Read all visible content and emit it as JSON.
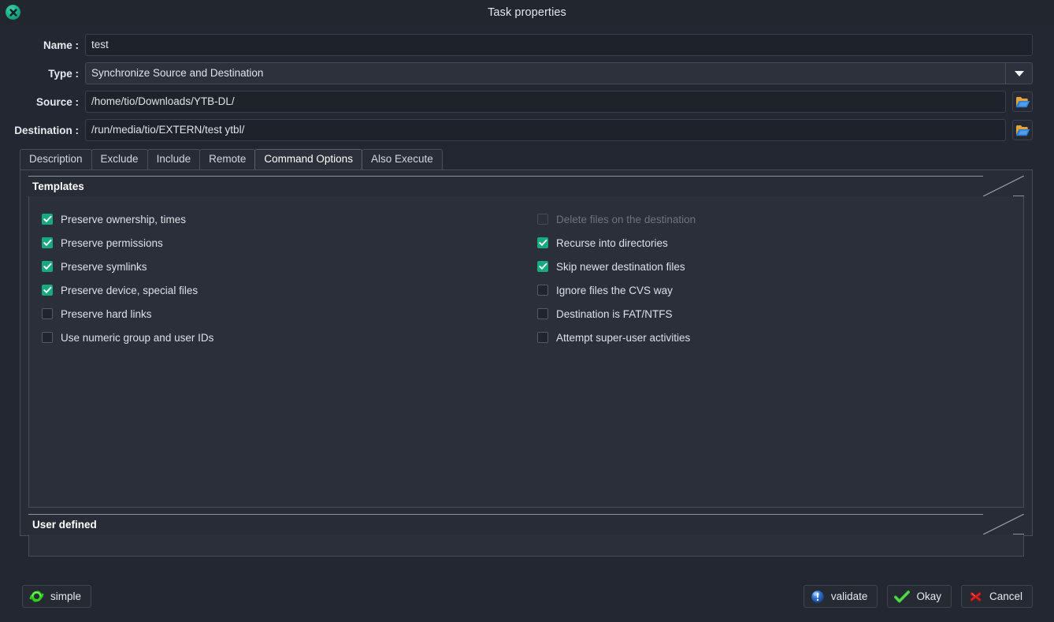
{
  "window": {
    "title": "Task properties",
    "close_icon": "close-circle-icon"
  },
  "form": {
    "name": {
      "label": "Name :",
      "value": "test"
    },
    "type": {
      "label": "Type :",
      "value": "Synchronize Source and Destination",
      "arrow_icon": "chevron-down-icon"
    },
    "source": {
      "label": "Source :",
      "value": "/home/tio/Downloads/YTB-DL/",
      "browse_icon": "folder-open-icon"
    },
    "destination": {
      "label": "Destination :",
      "value": "/run/media/tio/EXTERN/test ytbl/",
      "browse_icon": "folder-open-icon"
    }
  },
  "tabs": [
    {
      "label": "Description",
      "active": false
    },
    {
      "label": "Exclude",
      "active": false
    },
    {
      "label": "Include",
      "active": false
    },
    {
      "label": "Remote",
      "active": false
    },
    {
      "label": "Command Options",
      "active": true
    },
    {
      "label": "Also Execute",
      "active": false
    }
  ],
  "templates": {
    "title": "Templates",
    "left_options": [
      {
        "label": "Preserve ownership, times",
        "checked": true,
        "disabled": false
      },
      {
        "label": "Preserve permissions",
        "checked": true,
        "disabled": false
      },
      {
        "label": "Preserve symlinks",
        "checked": true,
        "disabled": false
      },
      {
        "label": "Preserve device, special files",
        "checked": true,
        "disabled": false
      },
      {
        "label": "Preserve hard links",
        "checked": false,
        "disabled": false
      },
      {
        "label": "Use numeric group and user IDs",
        "checked": false,
        "disabled": false
      }
    ],
    "right_options": [
      {
        "label": "Delete files on the destination",
        "checked": false,
        "disabled": true
      },
      {
        "label": "Recurse into directories",
        "checked": true,
        "disabled": false
      },
      {
        "label": "Skip newer destination files",
        "checked": true,
        "disabled": false
      },
      {
        "label": "Ignore files the CVS way",
        "checked": false,
        "disabled": false
      },
      {
        "label": "Destination is FAT/NTFS",
        "checked": false,
        "disabled": false
      },
      {
        "label": "Attempt super-user activities",
        "checked": false,
        "disabled": false
      }
    ]
  },
  "user_defined": {
    "title": "User defined"
  },
  "footer": {
    "simple": {
      "label": "simple",
      "icon": "sync-arrows-icon"
    },
    "validate": {
      "label": "validate",
      "icon": "info-exclamation-icon"
    },
    "okay": {
      "label": "Okay",
      "icon": "check-mark-icon"
    },
    "cancel": {
      "label": "Cancel",
      "icon": "red-cross-icon"
    }
  },
  "colors": {
    "accent_green": "#17a97f",
    "window_bg": "#232731",
    "panel_bg": "#272c36",
    "ok_green": "#3fcc36",
    "cancel_red": "#d62323",
    "validate_blue": "#2f6fd0"
  }
}
